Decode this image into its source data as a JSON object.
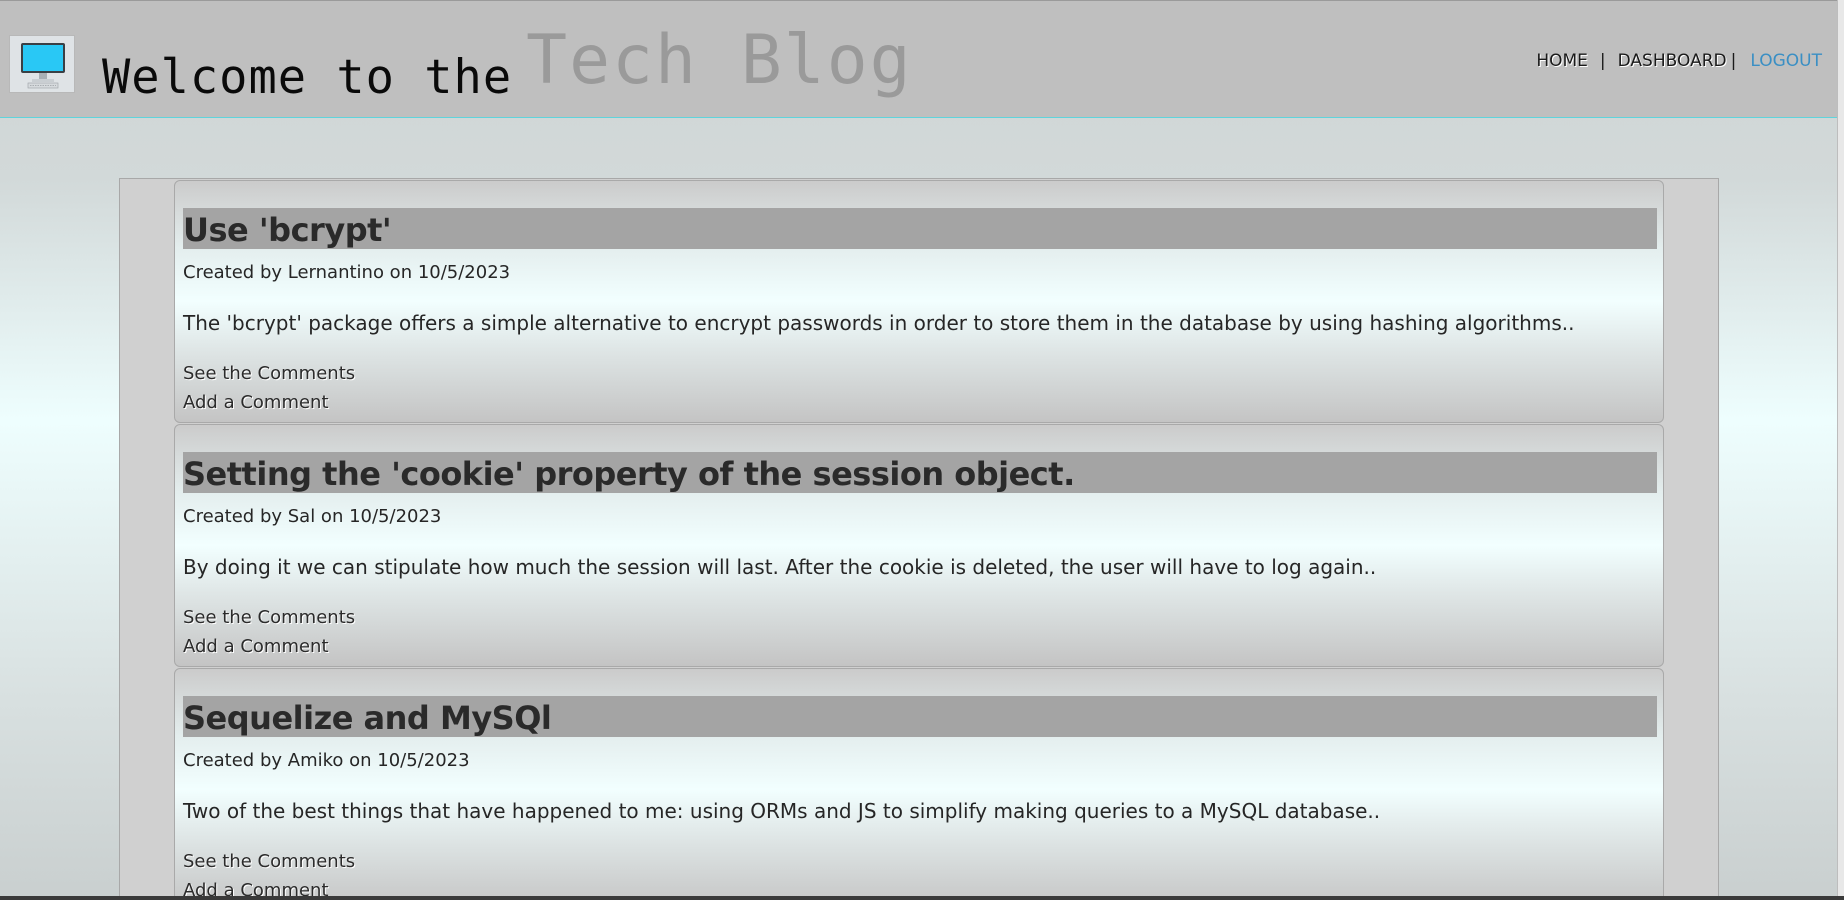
{
  "header": {
    "title_prefix": "Welcome to the",
    "title_brand": "Tech Blog",
    "logo_icon": "computer-monitor-icon"
  },
  "nav": {
    "home": "HOME",
    "separator": "|",
    "dashboard": "DASHBOARD",
    "logout": "LOGOUT"
  },
  "colors": {
    "header_bg": "#bfbfbf",
    "accent_line": "#5fd4dc",
    "logout_link": "#3a8fc4",
    "post_title_bg": "#a4a4a4"
  },
  "posts": [
    {
      "title": "Use 'bcrypt'",
      "meta": "Created by Lernantino on 10/5/2023",
      "body": "The 'bcrypt' package offers a simple alternative to encrypt passwords in order to store them in the database by using hashing algorithms..",
      "see_comments": "See the Comments",
      "add_comment": "Add a Comment"
    },
    {
      "title": "Setting the 'cookie' property of the session object.",
      "meta": "Created by Sal on 10/5/2023",
      "body": "By doing it we can stipulate how much the session will last. After the cookie is deleted, the user will have to log again..",
      "see_comments": "See the Comments",
      "add_comment": "Add a Comment"
    },
    {
      "title": "Sequelize and MySQl",
      "meta": "Created by Amiko on 10/5/2023",
      "body": "Two of the best things that have happened to me: using ORMs and JS to simplify making queries to a MySQL database..",
      "see_comments": "See the Comments",
      "add_comment": "Add a Comment"
    }
  ]
}
